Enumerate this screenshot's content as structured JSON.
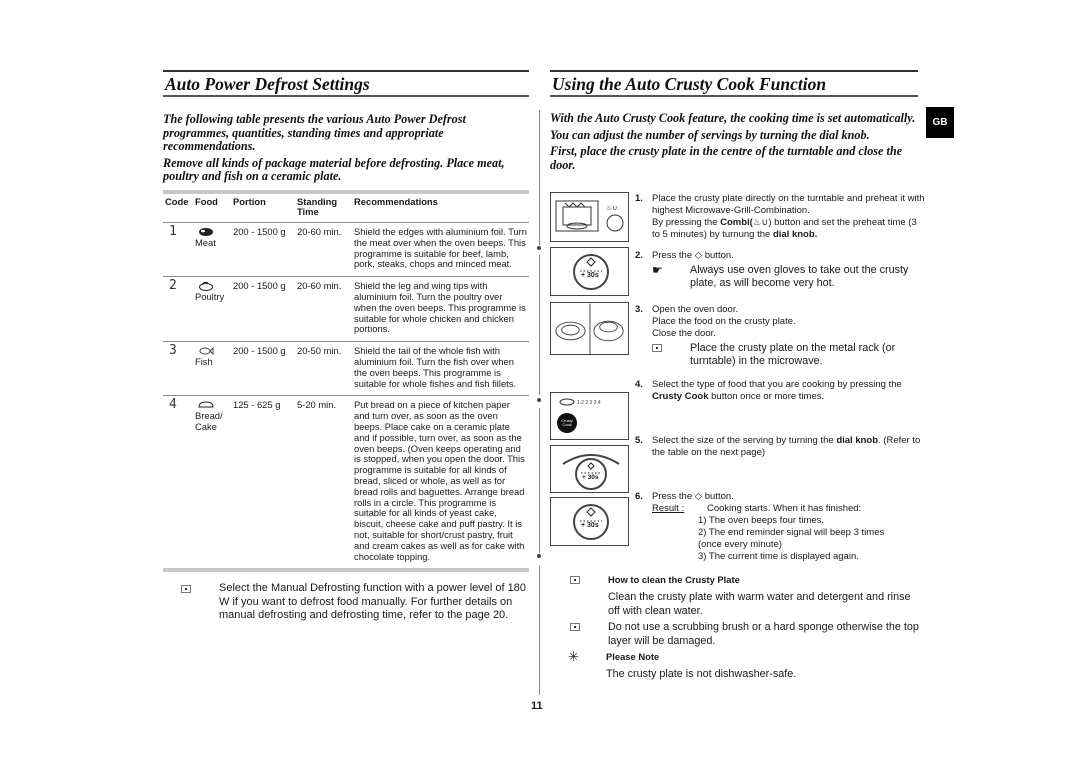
{
  "left": {
    "title": "Auto Power Defrost Settings",
    "intro": [
      "The following table presents the various Auto Power Defrost programmes, quantities, standing times and appropriate recommendations.",
      "Remove all kinds of package material before defrosting. Place meat, poultry and fish on a ceramic plate."
    ],
    "table": {
      "headers": {
        "code": "Code",
        "food": "Food",
        "portion": "Portion",
        "standing": "Standing Time",
        "rec": "Recommendations"
      },
      "rows": [
        {
          "code": "1",
          "food_icon": "meat-icon",
          "food": "Meat",
          "portion": "200 - 1500 g",
          "standing": "20-60 min.",
          "rec": "Shield the edges with aluminium foil. Turn the meat over when the oven beeps. This programme is suitable for beef, lamb, pork, steaks, chops and minced meat."
        },
        {
          "code": "2",
          "food_icon": "poultry-icon",
          "food": "Poultry",
          "portion": "200 - 1500 g",
          "standing": "20-60 min.",
          "rec": "Shield the leg and wing tips with aluminium foil. Turn the poultry over when the oven beeps. This programme is suitable for whole chicken and chicken portions."
        },
        {
          "code": "3",
          "food_icon": "fish-icon",
          "food": "Fish",
          "portion": "200 - 1500 g",
          "standing": "20-50 min.",
          "rec": "Shield the tail of the whole fish with aluminium foil. Turn the fish over when the oven beeps. This programme is suitable for whole fishes and fish fillets."
        },
        {
          "code": "4",
          "food_icon": "bread-icon",
          "food": "Bread/ Cake",
          "portion": "125 - 625 g",
          "standing": "5-20 min.",
          "rec": "Put bread on a piece of kitchen paper and turn over, as soon as the oven beeps. Place cake on a ceramic plate and if possible, turn over, as soon as the oven beeps. (Oven keeps operating and is stopped, when you open the door. This programme is suitable for all kinds of bread, sliced or whole, as well as for bread rolls and baguettes. Arrange bread rolls in a circle. This programme is suitable for all kinds of yeast cake, biscuit, cheese cake and puff pastry. It is not, suitable for short/crust pastry, fruit and cream cakes as well as for cake with chocolate topping."
        }
      ]
    },
    "note": "Select the Manual Defrosting function with a power level of 180 W if you want to defrost food manually. For further details on manual defrosting and defrosting time, refer to the page 20."
  },
  "right": {
    "title": "Using the Auto Crusty Cook Function",
    "intro": [
      "With the Auto Crusty Cook feature, the cooking time is set automatically.",
      "You can adjust the number of servings by turning the dial knob.",
      "First, place the crusty plate in the centre of the turntable and close the door."
    ],
    "steps": [
      {
        "num": "1.",
        "l1": "Place the crusty plate directly on the turntable and preheat it with highest Microwave-Grill-Combination.",
        "l2a": "By pressing the ",
        "l2b": "Combi(",
        "l2c": ") button and set the preheat time (3 to 5 minutes) by turnung the ",
        "l2d": "dial knob."
      },
      {
        "num": "2.",
        "a": "Press the ",
        "b": " button.",
        "hand": "Always use oven gloves to take out the crusty plate, as will become very hot."
      },
      {
        "num": "3.",
        "l1": "Open the oven door.",
        "l2": "Place the food on the crusty plate.",
        "l3": "Close the door.",
        "note": "Place the crusty plate on the metal rack (or turntable) in the microwave."
      },
      {
        "num": "4.",
        "a": "Select the type of food that you are cooking by pressing the ",
        "b": "Crusty Cook",
        "c": " button once or more times."
      },
      {
        "num": "5.",
        "a": "Select the size of the serving by turning the ",
        "b": "dial knob",
        "c": ". (Refer to the table on the next page)"
      },
      {
        "num": "6.",
        "a": "Press the ",
        "b": " button.",
        "result_label": "Result :",
        "result": "Cooking starts. When it has finished:",
        "items": [
          "1)  The oven beeps four times.",
          "2)  The end reminder signal will beep 3 times (once every minute)",
          "3)  The current time is displayed again."
        ]
      }
    ],
    "illus": {
      "plus30": "+ 30s",
      "crusty_btn": "Crusty Cook"
    },
    "clean_title": "How to clean the Crusty Plate",
    "clean_text": "Clean the crusty plate with warm water and detergent and rinse off with clean water.",
    "clean_note": "Do not use a scrubbing brush or a hard sponge otherwise the top layer will be damaged.",
    "please_title": "Please Note",
    "please_text": "The crusty plate is not dishwasher-safe."
  },
  "lang_tab": "GB",
  "page_number": "11"
}
